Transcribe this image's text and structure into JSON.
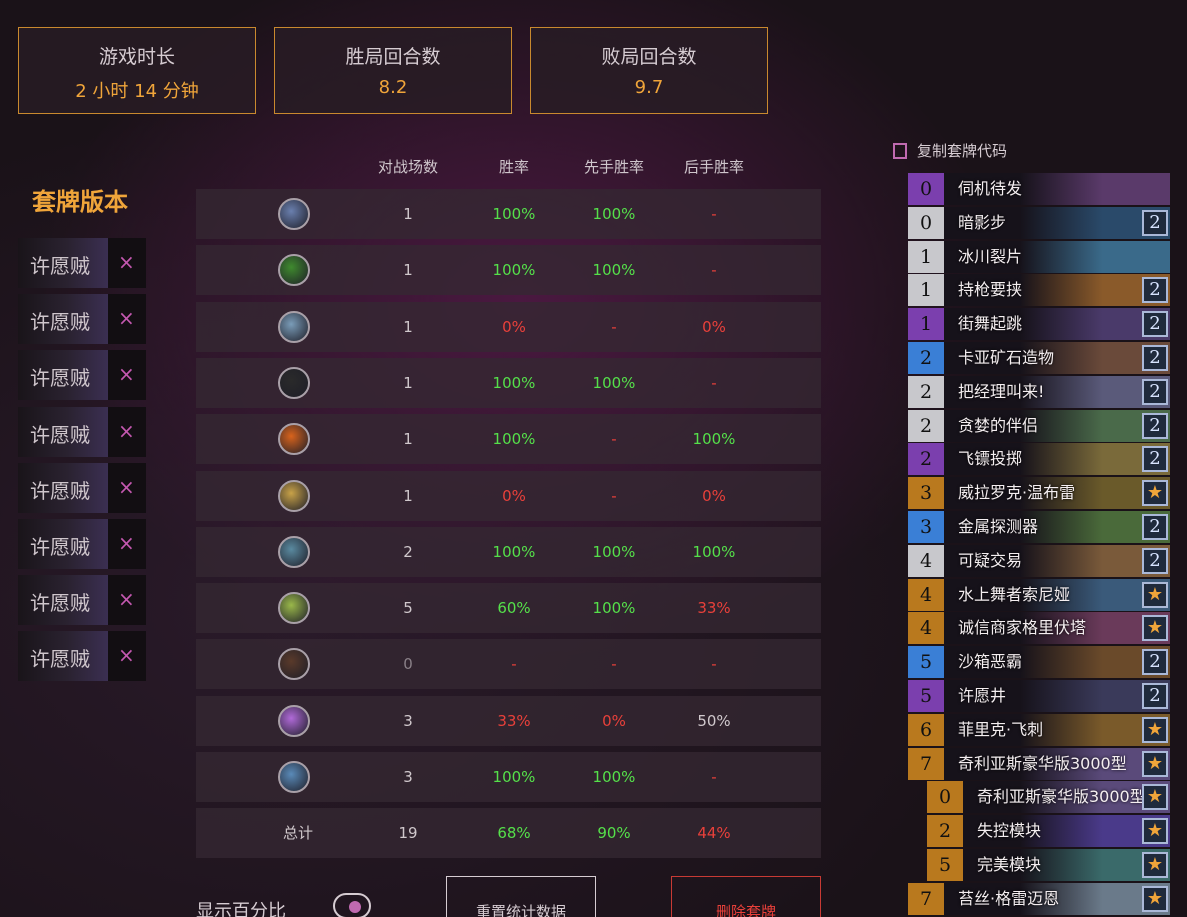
{
  "stats": [
    {
      "label": "游戏时长",
      "value": "2 小时 14 分钟"
    },
    {
      "label": "胜局回合数",
      "value": "8.2"
    },
    {
      "label": "败局回合数",
      "value": "9.7"
    }
  ],
  "versions": {
    "title": "套牌版本",
    "items": [
      "许愿贼",
      "许愿贼",
      "许愿贼",
      "许愿贼",
      "许愿贼",
      "许愿贼",
      "许愿贼",
      "许愿贼"
    ],
    "remove_symbol": "×"
  },
  "table": {
    "headers": [
      "对战场数",
      "胜率",
      "先手胜率",
      "后手胜率"
    ],
    "rows": [
      {
        "icon": "paladin-class-icon",
        "games": "1",
        "wr": "100%",
        "first": "100%",
        "second": "-"
      },
      {
        "icon": "hunter-class-icon",
        "games": "1",
        "wr": "100%",
        "first": "100%",
        "second": "-"
      },
      {
        "icon": "shaman-class-icon",
        "games": "1",
        "wr": "0%",
        "first": "-",
        "second": "0%"
      },
      {
        "icon": "rogue-class-icon",
        "games": "1",
        "wr": "100%",
        "first": "100%",
        "second": "-"
      },
      {
        "icon": "mage-class-icon",
        "games": "1",
        "wr": "100%",
        "first": "-",
        "second": "100%"
      },
      {
        "icon": "priest-class-icon",
        "games": "1",
        "wr": "0%",
        "first": "-",
        "second": "0%"
      },
      {
        "icon": "warrior-class-icon",
        "games": "2",
        "wr": "100%",
        "first": "100%",
        "second": "100%"
      },
      {
        "icon": "druid-class-icon",
        "games": "5",
        "wr": "60%",
        "first": "100%",
        "second": "33%"
      },
      {
        "icon": "warlock-class-icon",
        "games": "0",
        "wr": "-",
        "first": "-",
        "second": "-"
      },
      {
        "icon": "demon-hunter-class-icon",
        "games": "3",
        "wr": "33%",
        "first": "0%",
        "second": "50%"
      },
      {
        "icon": "death-knight-class-icon",
        "games": "3",
        "wr": "100%",
        "first": "100%",
        "second": "-"
      }
    ],
    "total": {
      "label": "总计",
      "games": "19",
      "wr": "68%",
      "first": "90%",
      "second": "44%"
    }
  },
  "controls": {
    "show_percent": "显示百分比",
    "reset": "重置统计数据",
    "delete": "删除套牌"
  },
  "deck": {
    "copy_label": "复制套牌代码",
    "cards": [
      {
        "cost": "0",
        "name": "伺机待发",
        "count": "",
        "rarity": "epic"
      },
      {
        "cost": "0",
        "name": "暗影步",
        "count": "2",
        "rarity": "common"
      },
      {
        "cost": "1",
        "name": "冰川裂片",
        "count": "",
        "rarity": "common"
      },
      {
        "cost": "1",
        "name": "持枪要挟",
        "count": "2",
        "rarity": "common"
      },
      {
        "cost": "1",
        "name": "街舞起跳",
        "count": "2",
        "rarity": "epic"
      },
      {
        "cost": "2",
        "name": "卡亚矿石造物",
        "count": "2",
        "rarity": "rare"
      },
      {
        "cost": "2",
        "name": "把经理叫来!",
        "count": "2",
        "rarity": "common"
      },
      {
        "cost": "2",
        "name": "贪婪的伴侣",
        "count": "2",
        "rarity": "common"
      },
      {
        "cost": "2",
        "name": "飞镖投掷",
        "count": "2",
        "rarity": "epic"
      },
      {
        "cost": "3",
        "name": "威拉罗克·温布雷",
        "count": "★",
        "rarity": "legendary"
      },
      {
        "cost": "3",
        "name": "金属探测器",
        "count": "2",
        "rarity": "rare"
      },
      {
        "cost": "4",
        "name": "可疑交易",
        "count": "2",
        "rarity": "common"
      },
      {
        "cost": "4",
        "name": "水上舞者索尼娅",
        "count": "★",
        "rarity": "legendary"
      },
      {
        "cost": "4",
        "name": "诚信商家格里伏塔",
        "count": "★",
        "rarity": "legendary"
      },
      {
        "cost": "5",
        "name": "沙箱恶霸",
        "count": "2",
        "rarity": "rare"
      },
      {
        "cost": "5",
        "name": "许愿井",
        "count": "2",
        "rarity": "epic"
      },
      {
        "cost": "6",
        "name": "菲里克·飞刺",
        "count": "★",
        "rarity": "legendary"
      },
      {
        "cost": "7",
        "name": "奇利亚斯豪华版3000型",
        "count": "★",
        "rarity": "legendary"
      },
      {
        "cost": "0",
        "name": "奇利亚斯豪华版3000型",
        "count": "★",
        "rarity": "legendary",
        "sub": true
      },
      {
        "cost": "2",
        "name": "失控模块",
        "count": "★",
        "rarity": "legendary",
        "sub": true
      },
      {
        "cost": "5",
        "name": "完美模块",
        "count": "★",
        "rarity": "legendary",
        "sub": true
      },
      {
        "cost": "7",
        "name": "苔丝·格雷迈恩",
        "count": "★",
        "rarity": "legendary"
      }
    ]
  },
  "colors": {
    "accent": "#f0a53a",
    "green": "#55e04a",
    "red": "#e8403a",
    "common": "#c8c8cc",
    "rare": "#3a7fd6",
    "epic": "#7b3fae",
    "legendary": "#b9791e"
  }
}
